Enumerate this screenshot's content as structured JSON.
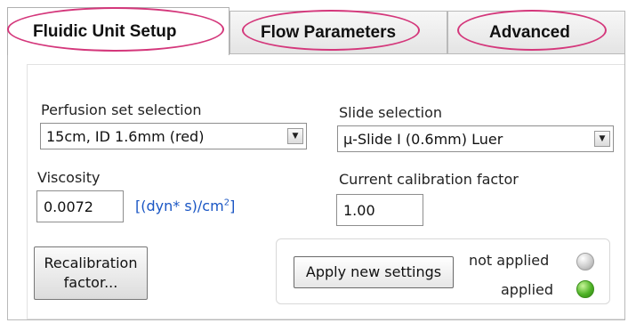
{
  "tabs": [
    {
      "label": "Fluidic Unit Setup",
      "active": true
    },
    {
      "label": "Flow Parameters",
      "active": false
    },
    {
      "label": "Advanced",
      "active": false
    }
  ],
  "perfusion": {
    "label": "Perfusion set selection",
    "value": "15cm, ID 1.6mm (red)"
  },
  "slide": {
    "label": "Slide selection",
    "value": "μ-Slide I (0.6mm) Luer"
  },
  "viscosity": {
    "label": "Viscosity",
    "value": "0.0072",
    "unit_main": "[(dyn* s)/cm",
    "unit_exp": "2",
    "unit_end": "]"
  },
  "calibration": {
    "label": "Current calibration factor",
    "value": "1.00"
  },
  "recal_button": {
    "line1": "Recalibration",
    "line2": "factor..."
  },
  "apply_button": {
    "label": "Apply new settings"
  },
  "status": {
    "not_applied": {
      "label": "not applied",
      "color": "#c9c9c9"
    },
    "applied": {
      "label": "applied",
      "color": "#4fb327"
    }
  },
  "annotation_color": "#d4377b"
}
